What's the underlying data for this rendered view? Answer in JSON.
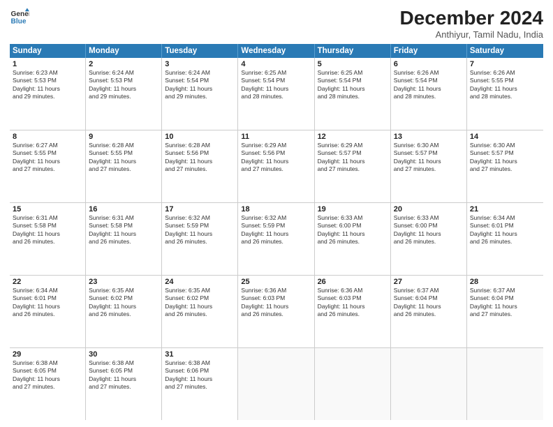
{
  "logo": {
    "line1": "General",
    "line2": "Blue"
  },
  "title": "December 2024",
  "location": "Anthiyur, Tamil Nadu, India",
  "weekdays": [
    "Sunday",
    "Monday",
    "Tuesday",
    "Wednesday",
    "Thursday",
    "Friday",
    "Saturday"
  ],
  "rows": [
    [
      {
        "day": "1",
        "lines": [
          "Sunrise: 6:23 AM",
          "Sunset: 5:53 PM",
          "Daylight: 11 hours",
          "and 29 minutes."
        ]
      },
      {
        "day": "2",
        "lines": [
          "Sunrise: 6:24 AM",
          "Sunset: 5:53 PM",
          "Daylight: 11 hours",
          "and 29 minutes."
        ]
      },
      {
        "day": "3",
        "lines": [
          "Sunrise: 6:24 AM",
          "Sunset: 5:54 PM",
          "Daylight: 11 hours",
          "and 29 minutes."
        ]
      },
      {
        "day": "4",
        "lines": [
          "Sunrise: 6:25 AM",
          "Sunset: 5:54 PM",
          "Daylight: 11 hours",
          "and 28 minutes."
        ]
      },
      {
        "day": "5",
        "lines": [
          "Sunrise: 6:25 AM",
          "Sunset: 5:54 PM",
          "Daylight: 11 hours",
          "and 28 minutes."
        ]
      },
      {
        "day": "6",
        "lines": [
          "Sunrise: 6:26 AM",
          "Sunset: 5:54 PM",
          "Daylight: 11 hours",
          "and 28 minutes."
        ]
      },
      {
        "day": "7",
        "lines": [
          "Sunrise: 6:26 AM",
          "Sunset: 5:55 PM",
          "Daylight: 11 hours",
          "and 28 minutes."
        ]
      }
    ],
    [
      {
        "day": "8",
        "lines": [
          "Sunrise: 6:27 AM",
          "Sunset: 5:55 PM",
          "Daylight: 11 hours",
          "and 27 minutes."
        ]
      },
      {
        "day": "9",
        "lines": [
          "Sunrise: 6:28 AM",
          "Sunset: 5:55 PM",
          "Daylight: 11 hours",
          "and 27 minutes."
        ]
      },
      {
        "day": "10",
        "lines": [
          "Sunrise: 6:28 AM",
          "Sunset: 5:56 PM",
          "Daylight: 11 hours",
          "and 27 minutes."
        ]
      },
      {
        "day": "11",
        "lines": [
          "Sunrise: 6:29 AM",
          "Sunset: 5:56 PM",
          "Daylight: 11 hours",
          "and 27 minutes."
        ]
      },
      {
        "day": "12",
        "lines": [
          "Sunrise: 6:29 AM",
          "Sunset: 5:57 PM",
          "Daylight: 11 hours",
          "and 27 minutes."
        ]
      },
      {
        "day": "13",
        "lines": [
          "Sunrise: 6:30 AM",
          "Sunset: 5:57 PM",
          "Daylight: 11 hours",
          "and 27 minutes."
        ]
      },
      {
        "day": "14",
        "lines": [
          "Sunrise: 6:30 AM",
          "Sunset: 5:57 PM",
          "Daylight: 11 hours",
          "and 27 minutes."
        ]
      }
    ],
    [
      {
        "day": "15",
        "lines": [
          "Sunrise: 6:31 AM",
          "Sunset: 5:58 PM",
          "Daylight: 11 hours",
          "and 26 minutes."
        ]
      },
      {
        "day": "16",
        "lines": [
          "Sunrise: 6:31 AM",
          "Sunset: 5:58 PM",
          "Daylight: 11 hours",
          "and 26 minutes."
        ]
      },
      {
        "day": "17",
        "lines": [
          "Sunrise: 6:32 AM",
          "Sunset: 5:59 PM",
          "Daylight: 11 hours",
          "and 26 minutes."
        ]
      },
      {
        "day": "18",
        "lines": [
          "Sunrise: 6:32 AM",
          "Sunset: 5:59 PM",
          "Daylight: 11 hours",
          "and 26 minutes."
        ]
      },
      {
        "day": "19",
        "lines": [
          "Sunrise: 6:33 AM",
          "Sunset: 6:00 PM",
          "Daylight: 11 hours",
          "and 26 minutes."
        ]
      },
      {
        "day": "20",
        "lines": [
          "Sunrise: 6:33 AM",
          "Sunset: 6:00 PM",
          "Daylight: 11 hours",
          "and 26 minutes."
        ]
      },
      {
        "day": "21",
        "lines": [
          "Sunrise: 6:34 AM",
          "Sunset: 6:01 PM",
          "Daylight: 11 hours",
          "and 26 minutes."
        ]
      }
    ],
    [
      {
        "day": "22",
        "lines": [
          "Sunrise: 6:34 AM",
          "Sunset: 6:01 PM",
          "Daylight: 11 hours",
          "and 26 minutes."
        ]
      },
      {
        "day": "23",
        "lines": [
          "Sunrise: 6:35 AM",
          "Sunset: 6:02 PM",
          "Daylight: 11 hours",
          "and 26 minutes."
        ]
      },
      {
        "day": "24",
        "lines": [
          "Sunrise: 6:35 AM",
          "Sunset: 6:02 PM",
          "Daylight: 11 hours",
          "and 26 minutes."
        ]
      },
      {
        "day": "25",
        "lines": [
          "Sunrise: 6:36 AM",
          "Sunset: 6:03 PM",
          "Daylight: 11 hours",
          "and 26 minutes."
        ]
      },
      {
        "day": "26",
        "lines": [
          "Sunrise: 6:36 AM",
          "Sunset: 6:03 PM",
          "Daylight: 11 hours",
          "and 26 minutes."
        ]
      },
      {
        "day": "27",
        "lines": [
          "Sunrise: 6:37 AM",
          "Sunset: 6:04 PM",
          "Daylight: 11 hours",
          "and 26 minutes."
        ]
      },
      {
        "day": "28",
        "lines": [
          "Sunrise: 6:37 AM",
          "Sunset: 6:04 PM",
          "Daylight: 11 hours",
          "and 27 minutes."
        ]
      }
    ],
    [
      {
        "day": "29",
        "lines": [
          "Sunrise: 6:38 AM",
          "Sunset: 6:05 PM",
          "Daylight: 11 hours",
          "and 27 minutes."
        ]
      },
      {
        "day": "30",
        "lines": [
          "Sunrise: 6:38 AM",
          "Sunset: 6:05 PM",
          "Daylight: 11 hours",
          "and 27 minutes."
        ]
      },
      {
        "day": "31",
        "lines": [
          "Sunrise: 6:38 AM",
          "Sunset: 6:06 PM",
          "Daylight: 11 hours",
          "and 27 minutes."
        ]
      },
      {
        "day": "",
        "lines": []
      },
      {
        "day": "",
        "lines": []
      },
      {
        "day": "",
        "lines": []
      },
      {
        "day": "",
        "lines": []
      }
    ]
  ]
}
